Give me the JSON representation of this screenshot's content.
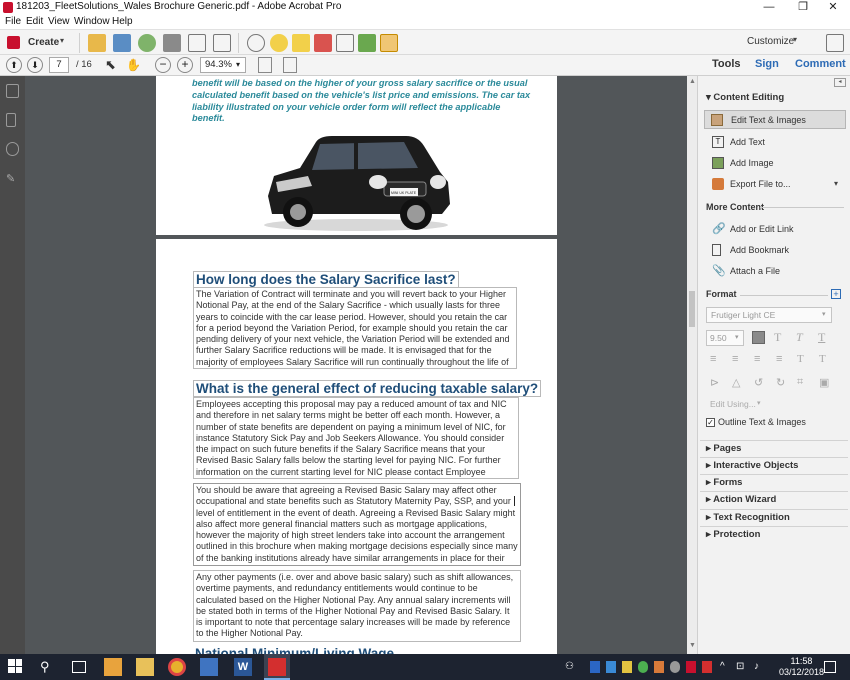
{
  "window": {
    "title": "181203_FleetSolutions_Wales Brochure Generic.pdf - Adobe Acrobat Pro",
    "minimize": "—",
    "maximize": "❐",
    "close": "✕"
  },
  "menu": [
    "File",
    "Edit",
    "View",
    "Window",
    "Help"
  ],
  "toolbar": {
    "create_label": "Create",
    "customize_label": "Customize"
  },
  "nav": {
    "page_current": "7",
    "page_total": "/ 16",
    "zoom": "94.3%",
    "tools_label": "Tools",
    "sign_label": "Sign",
    "comment_label": "Comment"
  },
  "doc": {
    "top_italic": "benefit will be based on the higher of your gross salary sacrifice or the usual calculated benefit based on the vehicle's list price and emissions.  The car tax liability illustrated on your vehicle order form will reflect the applicable benefit.",
    "car_plate": "MINI UK PLATE",
    "heading1": "How long does the Salary Sacrifice last?",
    "para1": "The Variation of Contract will terminate and you will revert back to your Higher Notional Pay, at the end of the Salary Sacrifice - which usually lasts for three years to coincide with the car lease period. However, should you retain the car for a period beyond the Variation Period, for example should you retain the car pending delivery of your next vehicle, the Variation Period will be extended and further Salary Sacrifice reductions will be made. It is envisaged that for the majority of employees Salary Sacrifice will run continually throughout the life of the lease.",
    "heading2": "What is the general effect of reducing taxable salary?",
    "para2": "Employees accepting this proposal may pay a reduced amount of tax and NIC and therefore in net salary terms might be better off each month. However, a number of state benefits are dependent on paying a minimum level of NIC, for instance Statutory Sick Pay and Job Seekers Allowance. You should consider the impact on such future benefits if the Salary Sacrifice means that your Revised Basic Salary falls below the starting level for paying NIC. For further information on the current starting level for NIC please contact Employee Services.",
    "para3": "You should be aware that agreeing a Revised Basic Salary may affect other occupational and state benefits such as Statutory Maternity Pay, SSP, and your level of entitlement in the event of death. Agreeing a Revised Basic Salary might also affect more general financial matters such as mortgage applications, however the majority of high street lenders take into account the arrangement outlined in this brochure when making mortgage decisions especially since many of the banking institutions already have similar arrangements in place for their own employees.",
    "para4": "Any other payments (i.e. over and above basic salary) such as shift allowances, overtime payments, and redundancy entitlements would continue to be calculated based on the Higher Notional Pay. Any annual salary increments will be stated both in terms of the Higher Notional Pay and Revised Basic Salary. It is important to note that percentage salary increases will be made by reference to the Higher Notional Pay.",
    "heading3_partial": "National Minimum/Living Wage"
  },
  "rightpane": {
    "content_editing": "Content Editing",
    "edit_text_images": "Edit Text & Images",
    "add_text": "Add Text",
    "add_image": "Add Image",
    "export_file": "Export File to...",
    "more_content": "More Content",
    "add_edit_link": "Add or Edit Link",
    "add_bookmark": "Add Bookmark",
    "attach_file": "Attach a File",
    "format": "Format",
    "font_name": "Frutiger Light CE",
    "font_size": "9.50",
    "edit_using": "Edit Using...",
    "outline_label": "Outline Text & Images",
    "sections": [
      "Pages",
      "Interactive Objects",
      "Forms",
      "Action Wizard",
      "Text Recognition",
      "Protection"
    ]
  },
  "taskbar": {
    "time": "11:58",
    "date": "03/12/2018"
  },
  "colors": {
    "teal_text": "#2b8a9a",
    "heading_blue": "#1f4e79",
    "doc_bg": "#525659",
    "sign_blue": "#2d6bb5"
  }
}
